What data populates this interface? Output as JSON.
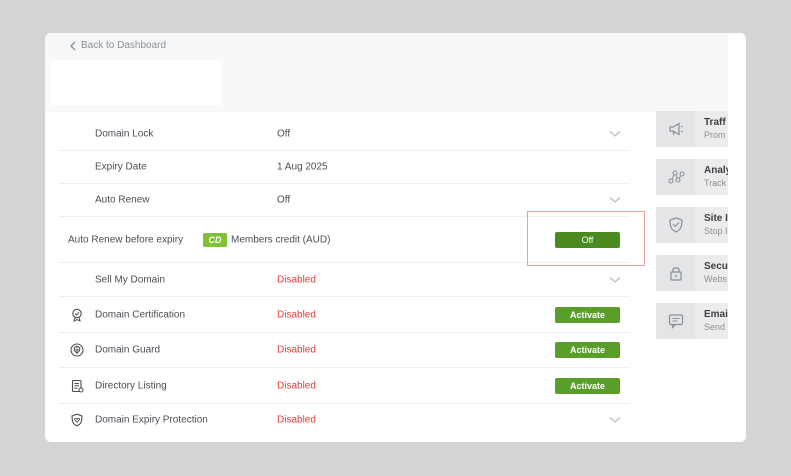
{
  "nav": {
    "back_label": "Back to Dashboard"
  },
  "settings": [
    {
      "label": "Domain Lock",
      "value": "Off",
      "status": "normal",
      "action": "chevron",
      "icon": ""
    },
    {
      "label": "Expiry Date",
      "value": "1 Aug 2025",
      "status": "normal",
      "action": "",
      "icon": ""
    },
    {
      "label": "Auto Renew",
      "value": "Off",
      "status": "normal",
      "action": "chevron",
      "icon": ""
    }
  ],
  "auto_renew_before_expiry": {
    "label": "Auto Renew before expiry",
    "badge": "CD",
    "credit_text": "Members credit (AUD)",
    "toggle_label": "Off"
  },
  "addons": [
    {
      "label": "Sell My Domain",
      "value": "Disabled",
      "action": "chevron",
      "icon": ""
    },
    {
      "label": "Domain Certification",
      "value": "Disabled",
      "action": "button",
      "button_label": "Activate",
      "icon": "certificate-icon"
    },
    {
      "label": "Domain Guard",
      "value": "Disabled",
      "action": "button",
      "button_label": "Activate",
      "icon": "globe-shield-icon"
    },
    {
      "label": "Directory Listing",
      "value": "Disabled",
      "action": "button",
      "button_label": "Activate",
      "icon": "directory-icon"
    },
    {
      "label": "Domain Expiry Protection",
      "value": "Disabled",
      "action": "chevron",
      "icon": "shield-heart-icon"
    }
  ],
  "sidebar": [
    {
      "title": "Traff",
      "subtitle": "Prom",
      "icon": "megaphone-icon"
    },
    {
      "title": "Analy",
      "subtitle": "Track",
      "icon": "analytics-icon"
    },
    {
      "title": "Site I",
      "subtitle": "Stop I",
      "icon": "shield-icon"
    },
    {
      "title": "Secu",
      "subtitle": "Webs",
      "icon": "lock-icon"
    },
    {
      "title": "Emai",
      "subtitle": "Send",
      "icon": "chat-icon"
    }
  ],
  "colors": {
    "accent_green": "#5a9e2a",
    "disabled_red": "#e53935",
    "badge_green": "#7ec23a",
    "page_bg": "#d4d4d4"
  }
}
